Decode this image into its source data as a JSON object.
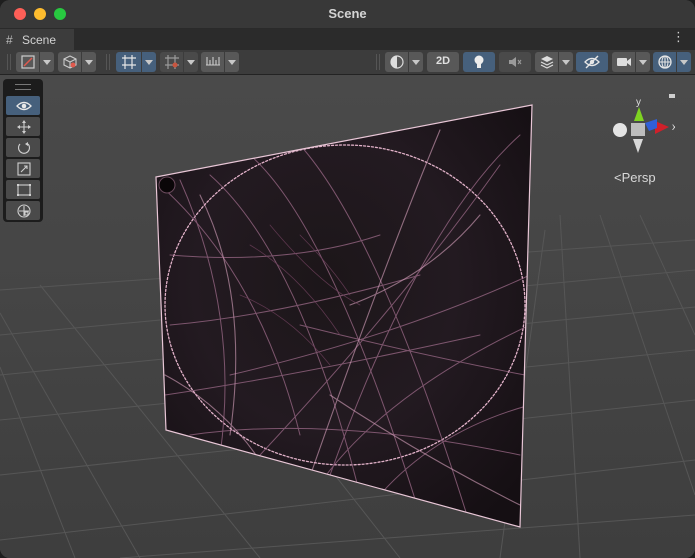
{
  "window": {
    "title": "Scene"
  },
  "tab": {
    "label": "Scene",
    "hash": "#",
    "menu": "⋮"
  },
  "toolbar": {
    "mode_2d": "2D"
  },
  "gizmo": {
    "y_label": "y",
    "x_label": "x",
    "projection_label": "Persp"
  },
  "icons": {
    "draw_mode": "shading-icon",
    "view_tool": "eye-icon",
    "move_tool": "move-icon",
    "rotate_tool": "rotate-icon",
    "scale_tool": "scale-icon",
    "rect_tool": "rect-icon",
    "transform_tool": "transform-icon"
  }
}
